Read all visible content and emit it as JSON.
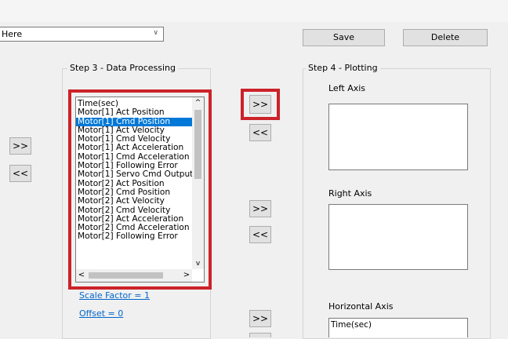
{
  "combo": {
    "value": "Here"
  },
  "buttons": {
    "save": "Save",
    "delete": "Delete"
  },
  "step3": {
    "title": "Step 3 - Data Processing",
    "items": [
      "Time(sec)",
      "Motor[1] Act Position",
      "Motor[1] Cmd Position",
      "Motor[1] Act Velocity",
      "Motor[1] Cmd Velocity",
      "Motor[1] Act Acceleration",
      "Motor[1] Cmd Acceleration",
      "Motor[1] Following Error",
      "Motor[1] Servo Cmd Output",
      "Motor[2] Act Position",
      "Motor[2] Cmd Position",
      "Motor[2] Act Velocity",
      "Motor[2] Cmd Velocity",
      "Motor[2] Act Acceleration",
      "Motor[2] Cmd Acceleration",
      "Motor[2] Following Error"
    ],
    "selected_index": 2,
    "scale_factor": "Scale Factor = 1",
    "offset": "Offset = 0"
  },
  "step4": {
    "title": "Step 4 - Plotting",
    "left_axis": "Left Axis",
    "right_axis": "Right Axis",
    "horizontal_axis": "Horizontal Axis",
    "horizontal_value": "Time(sec)"
  },
  "arrows": {
    "right": ">>",
    "left": "<<"
  },
  "scroll": {
    "up": "^",
    "down": "v",
    "left": "<",
    "right": ">"
  }
}
